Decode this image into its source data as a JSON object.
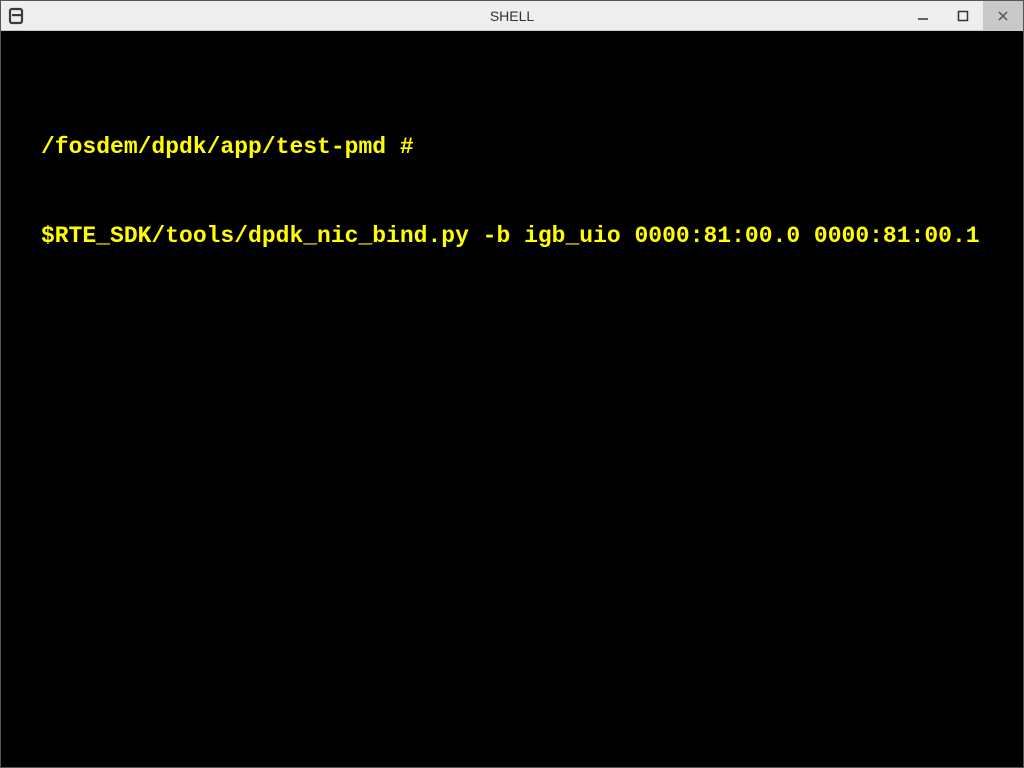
{
  "window": {
    "title": "SHELL"
  },
  "terminal": {
    "lines": [
      "/fosdem/dpdk/app/test-pmd #",
      "$RTE_SDK/tools/dpdk_nic_bind.py -b igb_uio 0000:81:00.0 0000:81:00.1"
    ]
  }
}
